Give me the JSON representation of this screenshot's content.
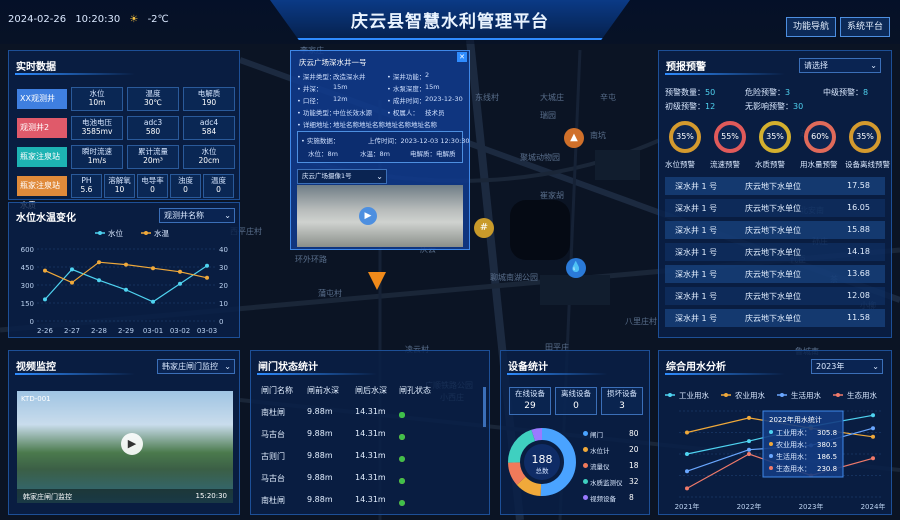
{
  "header": {
    "date": "2024-02-26",
    "time": "10:20:30",
    "temp": "-2℃",
    "title": "庆云县智慧水利管理平台",
    "btn_nav": "功能导航",
    "btn_sys": "系统平台"
  },
  "realtime": {
    "title": "实时数据",
    "stations": [
      {
        "name": "XX观测井",
        "color": "#3f7fe0",
        "cells": [
          [
            "水位",
            "10m"
          ],
          [
            "温度",
            "30℃"
          ],
          [
            "电解质",
            "190"
          ]
        ]
      },
      {
        "name": "观测井2",
        "color": "#e05a6a",
        "cells": [
          [
            "电池电压",
            "3585mv"
          ],
          [
            "adc3",
            "580"
          ],
          [
            "adc4",
            "584"
          ]
        ]
      },
      {
        "name": "瓶家注泉站",
        "color": "#1db3b3",
        "cells": [
          [
            "瞬时流速",
            "1m/s"
          ],
          [
            "累计流量",
            "20m³"
          ],
          [
            "水位",
            "20cm"
          ]
        ]
      },
      {
        "name": "瓶家注泉站水质",
        "color": "#e08a3a",
        "cells": [
          [
            "PH",
            "5.6"
          ],
          [
            "溶解氧",
            "10"
          ],
          [
            "电导率",
            "0"
          ],
          [
            "浊度",
            "0"
          ],
          [
            "温度",
            "0"
          ]
        ]
      }
    ]
  },
  "wl_chart": {
    "title": "水位水温变化",
    "select": "观测井名称"
  },
  "chart_data": {
    "type": "line",
    "categories": [
      "2-26",
      "2-27",
      "2-28",
      "2-29",
      "03-01",
      "03-02",
      "03-03"
    ],
    "series": [
      {
        "name": "水位",
        "values": [
          180,
          430,
          340,
          260,
          160,
          310,
          460
        ],
        "color": "#4fd3f0"
      },
      {
        "name": "水温",
        "values": [
          420,
          320,
          490,
          470,
          440,
          410,
          360
        ],
        "color": "#f0a93a"
      }
    ],
    "ylim": [
      0,
      600
    ],
    "y2lim": [
      0,
      40
    ],
    "yticks": [
      "600",
      "450",
      "300",
      "150",
      "0"
    ],
    "y2ticks": [
      "40",
      "30",
      "20",
      "10",
      "0"
    ]
  },
  "popup": {
    "title": "庆云广场深水井一号",
    "close": "✕",
    "rows": [
      [
        "• 深井类型：",
        "改造深水井",
        "• 深井功能：",
        "2"
      ],
      [
        "• 井深：",
        "15m",
        "• 水泵深度：",
        "15m"
      ],
      [
        "• 口径：",
        "12m",
        "• 成井时间：",
        "2023-12-30"
      ],
      [
        "• 功能类型：",
        "中位长效水源",
        "• 权属人：",
        "技术员"
      ],
      [
        "• 详细地址：",
        "地址名称地址名称地址名称地址名称",
        "",
        " "
      ]
    ],
    "live_label": "• 实施数据：",
    "live_time": "上传时间：2023-12-03 12:30:30",
    "live_vals": [
      "水位：8m",
      "水温：8m",
      "电解质：电解质"
    ],
    "cam_select": "庆云广场摄像1号"
  },
  "map": {
    "labels": [
      "李家庄",
      "东线村",
      "大城庄",
      "辛屯",
      "瑞园",
      "南坑",
      "聚城动物园",
      "崔家胡",
      "西平庄村",
      "鸣柳村",
      "环外环路",
      "聊城南湖公园",
      "蒲屯村",
      "庆云",
      "八里庄村",
      "田平庄",
      "赵张村",
      "孙庄",
      "茶",
      "北安南",
      "代臣",
      "小柳",
      "鲁城南",
      "凌云村",
      "广顺铁路公园",
      "小西庄"
    ]
  },
  "warning": {
    "title": "预报预警",
    "select": "请选择",
    "stats": [
      [
        "预警数量：",
        "50"
      ],
      [
        "危险预警：",
        "3"
      ],
      [
        "中级预警：",
        "8"
      ],
      [
        "初级预警：",
        "12"
      ],
      [
        "无影响预警：",
        "30"
      ]
    ],
    "rings": [
      [
        "35%",
        "水位预警",
        "#d49a2e"
      ],
      [
        "55%",
        "流速预警",
        "#e05a5a"
      ],
      [
        "35%",
        "水质预警",
        "#d4b02e"
      ],
      [
        "60%",
        "用水量预警",
        "#e06a5a"
      ],
      [
        "35%",
        "设备离线预警",
        "#d49a2e"
      ]
    ],
    "rows": [
      [
        "深水井 1 号",
        "庆云地下水单位",
        "17.58"
      ],
      [
        "深水井 1 号",
        "庆云地下水单位",
        "16.05"
      ],
      [
        "深水井 1 号",
        "庆云地下水单位",
        "15.88"
      ],
      [
        "深水井 1 号",
        "庆云地下水单位",
        "14.18"
      ],
      [
        "深水井 1 号",
        "庆云地下水单位",
        "13.68"
      ],
      [
        "深水井 1 号",
        "庆云地下水单位",
        "12.08"
      ],
      [
        "深水井 1 号",
        "庆云地下水单位",
        "11.58"
      ]
    ]
  },
  "video": {
    "title": "视频监控",
    "select": "韩家庄闸门监控",
    "cam_id": "KTD-001",
    "caption": "韩家庄闸门监控",
    "time": "15:20:30"
  },
  "gate": {
    "title": "闸门状态统计",
    "headers": [
      "闸门名称",
      "闸前水深",
      "闸后水深",
      "闸孔状态"
    ],
    "rows": [
      [
        "南杜闸",
        "9.88m",
        "14.31m"
      ],
      [
        "马古台",
        "9.88m",
        "14.31m"
      ],
      [
        "古则门",
        "9.88m",
        "14.31m"
      ],
      [
        "马古台",
        "9.88m",
        "14.31m"
      ],
      [
        "南杜闸",
        "9.88m",
        "14.31m"
      ]
    ]
  },
  "device": {
    "title": "设备统计",
    "boxes": [
      [
        "在线设备",
        "29"
      ],
      [
        "离线设备",
        "0"
      ],
      [
        "损坏设备",
        "3"
      ]
    ],
    "total": "188",
    "total_unit": "总数",
    "items": [
      [
        "闸门",
        "80",
        "#4aa3ff"
      ],
      [
        "水位计",
        "20",
        "#f0a93a"
      ],
      [
        "流量仪",
        "18",
        "#f07a5a"
      ],
      [
        "水质监测仪",
        "32",
        "#3fd0c0"
      ],
      [
        "视频设备",
        "8",
        "#9a7aff"
      ]
    ]
  },
  "water": {
    "title": "综合用水分析",
    "select": "2023年",
    "legend": [
      [
        "工业用水",
        "#4fd3f0"
      ],
      [
        "农业用水",
        "#f0a93a"
      ],
      [
        "生活用水",
        "#6aa7ff"
      ],
      [
        "生态用水",
        "#f07a6a"
      ]
    ],
    "years": [
      "2021年",
      "2022年",
      "2023年",
      "2024年"
    ],
    "tip_title": "2022年用水统计",
    "tip": [
      [
        "工业用水：",
        "305.8"
      ],
      [
        "农业用水：",
        "380.5"
      ],
      [
        "生活用水：",
        "186.5"
      ],
      [
        "生态用水：",
        "230.8"
      ]
    ]
  }
}
